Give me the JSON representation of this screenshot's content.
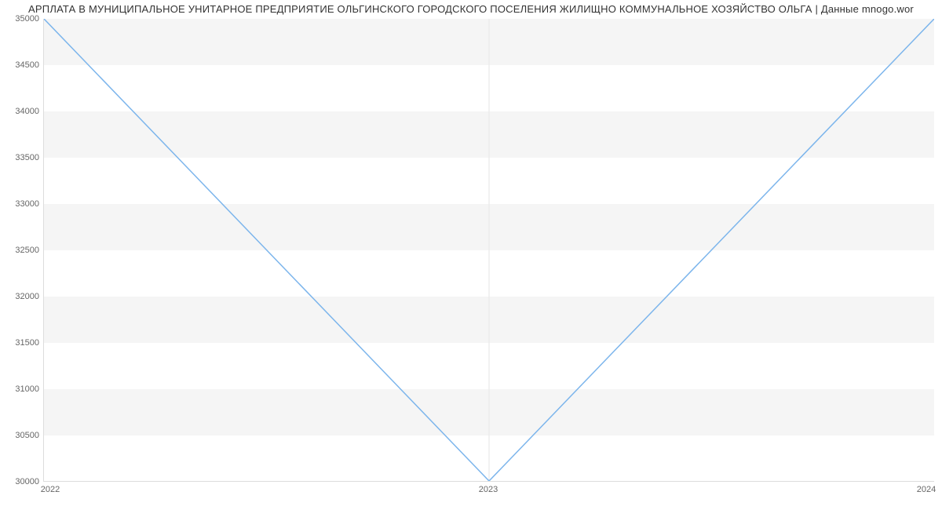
{
  "chart_data": {
    "type": "line",
    "title": "АРПЛАТА В МУНИЦИПАЛЬНОЕ УНИТАРНОЕ ПРЕДПРИЯТИЕ ОЛЬГИНСКОГО ГОРОДСКОГО ПОСЕЛЕНИЯ ЖИЛИЩНО КОММУНАЛЬНОЕ ХОЗЯЙСТВО ОЛЬГА | Данные mnogo.wor",
    "x": [
      "2022",
      "2023",
      "2024"
    ],
    "values": [
      35000,
      30000,
      35000
    ],
    "xlabel": "",
    "ylabel": "",
    "ylim": [
      30000,
      35000
    ],
    "y_ticks": [
      30000,
      30500,
      31000,
      31500,
      32000,
      32500,
      33000,
      33500,
      34000,
      34500,
      35000
    ],
    "x_ticks": [
      "2022",
      "2023",
      "2024"
    ],
    "line_color": "#7cb5ec"
  }
}
